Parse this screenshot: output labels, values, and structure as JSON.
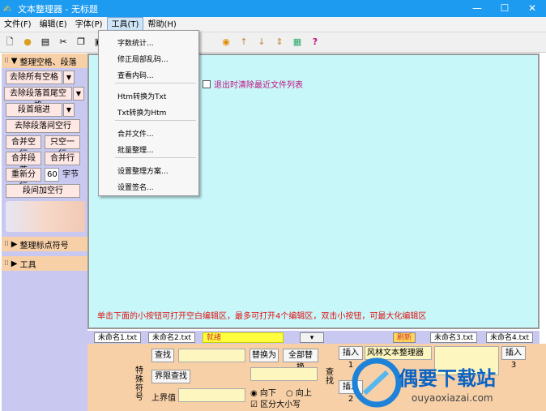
{
  "window": {
    "title": "文本整理器 - 无标题"
  },
  "menubar": [
    "文件(F)",
    "编辑(E)",
    "字体(P)",
    "工具(T)",
    "帮助(H)"
  ],
  "toolbar_icons": [
    "new-icon",
    "open-icon",
    "save-icon",
    "cut-icon",
    "copy-icon",
    "paste-icon",
    "run-icon",
    "up-arrow-icon",
    "down-arrow-icon",
    "updown-icon",
    "palette-icon",
    "help-icon"
  ],
  "tools_menu": {
    "items": [
      "字数统计...",
      "修正局部乱码...",
      "查看内码...",
      "Htm转换为Txt",
      "Txt转换为Htm",
      "合并文件...",
      "批量整理...",
      "设置整理方案...",
      "设置签名..."
    ]
  },
  "left_panel": {
    "section1": "整理空格、段落",
    "buttons": {
      "remove_all_spaces": "去除所有空格",
      "remove_leading_trailing": "去除段落首尾空格",
      "indent": "段首缩进",
      "remove_blank_lines": "去除段落间空行",
      "merge_blank": "合并空行",
      "one_blank": "只空一行",
      "merge_paragraph": "合并段落",
      "merge_line": "合并行",
      "rebreak": "重新分行",
      "chars_value": "60",
      "chars_unit": "字节",
      "add_blank": "段间加空行"
    },
    "section2": "整理标点符号",
    "section3": "工具"
  },
  "editor": {
    "exit_checkbox": "退出时清除最近文件列表",
    "hint": "单击下面的小按钮可打开空白编辑区，最多可打开4个编辑区，双击小按钮，可最大化编辑区",
    "tabs": [
      "未命名1.txt",
      "未命名2.txt",
      "就绪",
      "未命名3.txt",
      "未命名4.txt"
    ],
    "status_tab": "刷新"
  },
  "bottom": {
    "special_label": "特殊符号",
    "find": "查找",
    "replace": "替换为",
    "replace_all": "全部替换",
    "boundary_find": "界限查找",
    "upper": "上界值",
    "down": "向下",
    "up": "向上",
    "case": "区分大小写",
    "search_label": "查找",
    "insert1": "插入1",
    "insert2": "插入2",
    "insert3": "插入3",
    "insert1_value": "风林文本整理器"
  },
  "watermark": {
    "brand": "偶要下载站",
    "url": "ouyaoxiazai.com"
  }
}
